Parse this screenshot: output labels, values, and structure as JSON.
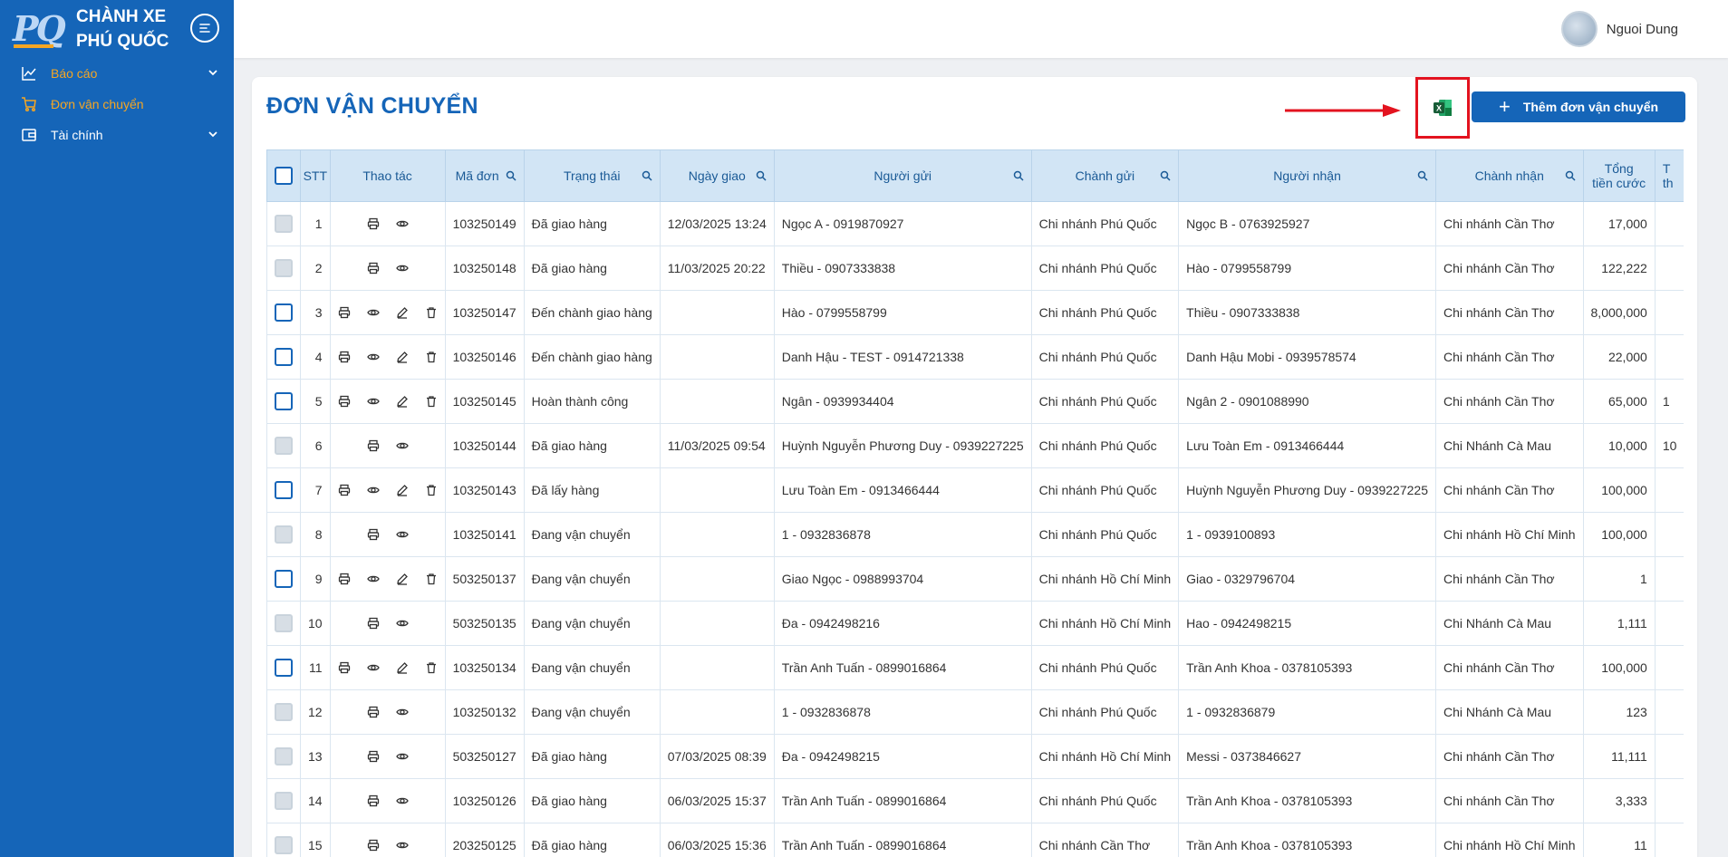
{
  "brand": {
    "line1": "CHÀNH XE",
    "line2": "PHÚ QUỐC",
    "logo_text": "PQ"
  },
  "sidebar": {
    "items": [
      {
        "label": "Báo cáo",
        "icon": "chart-line-icon",
        "has_children": true
      },
      {
        "label": "Đơn vận chuyển",
        "icon": "cart-icon",
        "has_children": false
      },
      {
        "label": "Tài chính",
        "icon": "wallet-icon",
        "has_children": true
      }
    ]
  },
  "user": {
    "name": "Nguoi Dung"
  },
  "page": {
    "title": "ĐƠN VẬN CHUYỂN",
    "add_button": "Thêm đơn vận chuyển",
    "export_icon": "excel-icon"
  },
  "table": {
    "headers": {
      "stt": "STT",
      "actions": "Thao tác",
      "code": "Mã đơn",
      "status": "Trạng thái",
      "delivery_date": "Ngày giao",
      "sender": "Người gửi",
      "send_branch": "Chành gửi",
      "receiver": "Người nhận",
      "recv_branch": "Chành nhận",
      "total_1": "Tổng",
      "total_2": "tiền cước",
      "extra_1": "T",
      "extra_2": "th"
    },
    "rows": [
      {
        "stt": "1",
        "editable": false,
        "code": "103250149",
        "status": "Đã giao hàng",
        "date": "12/03/2025 13:24",
        "sender": "Ngọc A - 0919870927",
        "send_branch": "Chi nhánh Phú Quốc",
        "receiver": "Ngọc B - 0763925927",
        "recv_branch": "Chi nhánh Cần Thơ",
        "total": "17,000",
        "extra": ""
      },
      {
        "stt": "2",
        "editable": false,
        "code": "103250148",
        "status": "Đã giao hàng",
        "date": "11/03/2025 20:22",
        "sender": "Thiều - 0907333838",
        "send_branch": "Chi nhánh Phú Quốc",
        "receiver": "Hào - 0799558799",
        "recv_branch": "Chi nhánh Cần Thơ",
        "total": "122,222",
        "extra": ""
      },
      {
        "stt": "3",
        "editable": true,
        "code": "103250147",
        "status": "Đến chành giao hàng",
        "date": "",
        "sender": "Hào - 0799558799",
        "send_branch": "Chi nhánh Phú Quốc",
        "receiver": "Thiều - 0907333838",
        "recv_branch": "Chi nhánh Cần Thơ",
        "total": "8,000,000",
        "extra": ""
      },
      {
        "stt": "4",
        "editable": true,
        "code": "103250146",
        "status": "Đến chành giao hàng",
        "date": "",
        "sender": "Danh Hậu - TEST - 0914721338",
        "send_branch": "Chi nhánh Phú Quốc",
        "receiver": "Danh Hậu Mobi - 0939578574",
        "recv_branch": "Chi nhánh Cần Thơ",
        "total": "22,000",
        "extra": ""
      },
      {
        "stt": "5",
        "editable": true,
        "code": "103250145",
        "status": "Hoàn thành công",
        "date": "",
        "sender": "Ngân - 0939934404",
        "send_branch": "Chi nhánh Phú Quốc",
        "receiver": "Ngân 2 - 0901088990",
        "recv_branch": "Chi nhánh Cần Thơ",
        "total": "65,000",
        "extra": "1"
      },
      {
        "stt": "6",
        "editable": false,
        "code": "103250144",
        "status": "Đã giao hàng",
        "date": "11/03/2025 09:54",
        "sender": "Huỳnh Nguyễn Phương Duy - 0939227225",
        "send_branch": "Chi nhánh Phú Quốc",
        "receiver": "Lưu Toàn Em - 0913466444",
        "recv_branch": "Chi Nhánh Cà Mau",
        "total": "10,000",
        "extra": "10"
      },
      {
        "stt": "7",
        "editable": true,
        "code": "103250143",
        "status": "Đã lấy hàng",
        "date": "",
        "sender": "Lưu Toàn Em - 0913466444",
        "send_branch": "Chi nhánh Phú Quốc",
        "receiver": "Huỳnh Nguyễn Phương Duy - 0939227225",
        "recv_branch": "Chi nhánh Cần Thơ",
        "total": "100,000",
        "extra": ""
      },
      {
        "stt": "8",
        "editable": false,
        "code": "103250141",
        "status": "Đang vận chuyển",
        "date": "",
        "sender": "1 - 0932836878",
        "send_branch": "Chi nhánh Phú Quốc",
        "receiver": "1 - 0939100893",
        "recv_branch": "Chi nhánh Hồ Chí Minh",
        "total": "100,000",
        "extra": ""
      },
      {
        "stt": "9",
        "editable": true,
        "code": "503250137",
        "status": "Đang vận chuyển",
        "date": "",
        "sender": "Giao Ngọc - 0988993704",
        "send_branch": "Chi nhánh Hồ Chí Minh",
        "receiver": "Giao - 0329796704",
        "recv_branch": "Chi nhánh Cần Thơ",
        "total": "1",
        "extra": ""
      },
      {
        "stt": "10",
        "editable": false,
        "code": "503250135",
        "status": "Đang vận chuyển",
        "date": "",
        "sender": "Đa - 0942498216",
        "send_branch": "Chi nhánh Hồ Chí Minh",
        "receiver": "Hao - 0942498215",
        "recv_branch": "Chi Nhánh Cà Mau",
        "total": "1,111",
        "extra": ""
      },
      {
        "stt": "11",
        "editable": true,
        "code": "103250134",
        "status": "Đang vận chuyển",
        "date": "",
        "sender": "Trần Anh Tuấn - 0899016864",
        "send_branch": "Chi nhánh Phú Quốc",
        "receiver": "Trần Anh Khoa - 0378105393",
        "recv_branch": "Chi nhánh Cần Thơ",
        "total": "100,000",
        "extra": ""
      },
      {
        "stt": "12",
        "editable": false,
        "code": "103250132",
        "status": "Đang vận chuyển",
        "date": "",
        "sender": "1 - 0932836878",
        "send_branch": "Chi nhánh Phú Quốc",
        "receiver": "1 - 0932836879",
        "recv_branch": "Chi Nhánh Cà Mau",
        "total": "123",
        "extra": ""
      },
      {
        "stt": "13",
        "editable": false,
        "code": "503250127",
        "status": "Đã giao hàng",
        "date": "07/03/2025 08:39",
        "sender": "Đa - 0942498215",
        "send_branch": "Chi nhánh Hồ Chí Minh",
        "receiver": "Messi - 0373846627",
        "recv_branch": "Chi nhánh Cần Thơ",
        "total": "11,111",
        "extra": ""
      },
      {
        "stt": "14",
        "editable": false,
        "code": "103250126",
        "status": "Đã giao hàng",
        "date": "06/03/2025 15:37",
        "sender": "Trần Anh Tuấn - 0899016864",
        "send_branch": "Chi nhánh Phú Quốc",
        "receiver": "Trần Anh Khoa - 0378105393",
        "recv_branch": "Chi nhánh Cần Thơ",
        "total": "3,333",
        "extra": ""
      },
      {
        "stt": "15",
        "editable": false,
        "code": "203250125",
        "status": "Đã giao hàng",
        "date": "06/03/2025 15:36",
        "sender": "Trần Anh Tuấn - 0899016864",
        "send_branch": "Chi nhánh Cần Thơ",
        "receiver": "Trần Anh Khoa - 0378105393",
        "recv_branch": "Chi nhánh Hồ Chí Minh",
        "total": "11",
        "extra": ""
      }
    ]
  },
  "colors": {
    "primary": "#1565b8",
    "accent": "#f5a623",
    "highlight": "#e3131f",
    "excel": "#1d7a45"
  }
}
